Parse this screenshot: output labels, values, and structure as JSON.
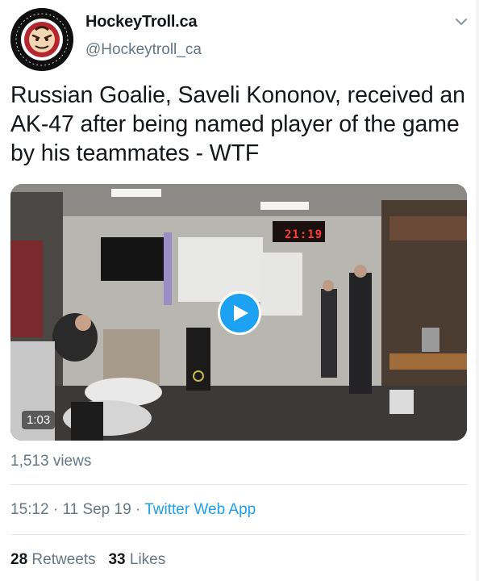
{
  "author": {
    "display_name": "HockeyTroll.ca",
    "handle": "@Hockeytroll_ca",
    "avatar_icon": "hockey-troll-logo-icon"
  },
  "tweet": {
    "text": "Russian Goalie, Saveli Kononov,  received an\nAK-47 after being named player of the game\nby his teammates - WTF"
  },
  "media": {
    "type": "video",
    "duration": "1:03",
    "scene_clock": "21:19",
    "play_icon": "play-icon"
  },
  "views": "1,513 views",
  "meta": {
    "time": "15:12",
    "separator": " · ",
    "date": "11 Sep 19",
    "source": "Twitter Web App"
  },
  "stats": {
    "retweets_count": "28",
    "retweets_label": "Retweets",
    "likes_count": "33",
    "likes_label": "Likes"
  },
  "colors": {
    "accent": "#1da1f2",
    "text_primary": "#14171a",
    "text_secondary": "#657786",
    "divider": "#e1e8ed"
  }
}
